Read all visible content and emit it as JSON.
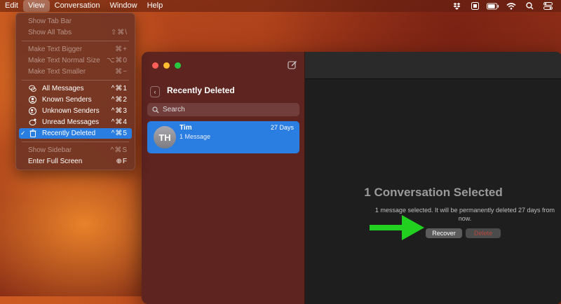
{
  "menubar": {
    "items": [
      "Edit",
      "View",
      "Conversation",
      "Window",
      "Help"
    ],
    "active_index": 1
  },
  "view_menu": {
    "groups": [
      [
        {
          "label": "Show Tab Bar",
          "shortcut": "",
          "enabled": false
        },
        {
          "label": "Show All Tabs",
          "shortcut": "⇧⌘\\",
          "enabled": false
        }
      ],
      [
        {
          "label": "Make Text Bigger",
          "shortcut": "⌘+",
          "enabled": false
        },
        {
          "label": "Make Text Normal Size",
          "shortcut": "⌥⌘0",
          "enabled": false
        },
        {
          "label": "Make Text Smaller",
          "shortcut": "⌘−",
          "enabled": false
        }
      ],
      [
        {
          "label": "All Messages",
          "shortcut": "^⌘1",
          "icon": "chat-bubbles-icon",
          "enabled": true
        },
        {
          "label": "Known Senders",
          "shortcut": "^⌘2",
          "icon": "person-circle-icon",
          "enabled": true
        },
        {
          "label": "Unknown Senders",
          "shortcut": "^⌘3",
          "icon": "person-question-icon",
          "enabled": true
        },
        {
          "label": "Unread Messages",
          "shortcut": "^⌘4",
          "icon": "unread-bubble-icon",
          "enabled": true
        },
        {
          "label": "Recently Deleted",
          "shortcut": "^⌘5",
          "icon": "trash-icon",
          "enabled": true,
          "checked": true,
          "selected": true
        }
      ],
      [
        {
          "label": "Show Sidebar",
          "shortcut": "^⌘S",
          "enabled": false
        },
        {
          "label": "Enter Full Screen",
          "shortcut": "⊕F",
          "enabled": true
        }
      ]
    ]
  },
  "sidebar": {
    "title": "Recently Deleted",
    "search_placeholder": "Search",
    "conversation": {
      "initials": "TH",
      "name": "Tim",
      "date": "27 Days",
      "preview": "1 Message"
    }
  },
  "main": {
    "title": "1 Conversation Selected",
    "subtitle": "1 message selected. It will be permanently deleted 27 days from now.",
    "recover_label": "Recover",
    "delete_label": "Delete"
  },
  "colors": {
    "accent": "#2a7de1",
    "arrow": "#22d120",
    "delete_text": "#b6483c"
  }
}
